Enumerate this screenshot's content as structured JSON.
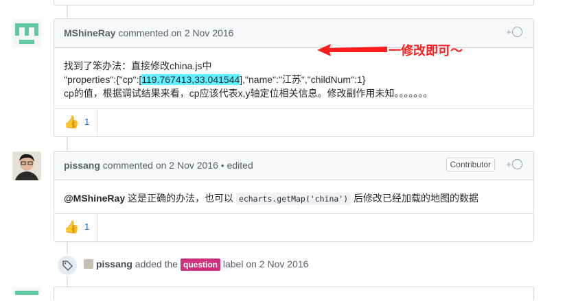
{
  "comments": [
    {
      "author": "MShineRay",
      "action": "commented on 2 Nov 2016",
      "edited": "",
      "body": {
        "line1": "找到了笨办法：直接修改china.js中",
        "line2_pre": "\"properties\":{\"cp\":[",
        "line2_highlight": "119.767413,33.041544",
        "line2_post": "],\"name\":\"江苏\",\"childNum\":1}",
        "line3": "cp的值，根据调试结果来看，cp应该代表x,y轴定位相关信息。修改副作用未知。。。。。。。"
      },
      "reaction": {
        "emoji": "👍",
        "count": "1"
      }
    },
    {
      "author": "pissang",
      "action": "commented on 2 Nov 2016",
      "edited": " • edited",
      "badge": "Contributor",
      "body": {
        "mention": "@MShineRay",
        "text1": " 这是正确的办法，也可以 ",
        "code": "echarts.getMap('china')",
        "text2": " 后修改已经加载的地图的数据"
      },
      "reaction": {
        "emoji": "👍",
        "count": "1"
      }
    }
  ],
  "add_reaction_label": "+",
  "event": {
    "icon": "tag-icon",
    "actor": "pissang",
    "text1": "added the",
    "label": "question",
    "label_color": "#cc317c",
    "text2": "label on 2 Nov 2016"
  },
  "annotation": {
    "text": "一修改即可～",
    "color": "#ff1d1d"
  }
}
